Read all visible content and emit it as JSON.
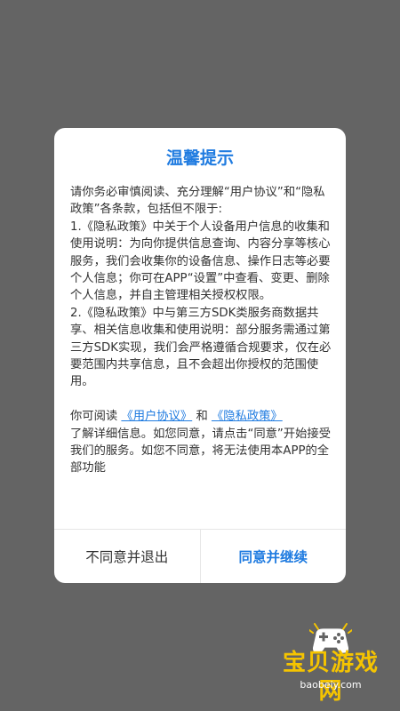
{
  "dialog": {
    "title": "温馨提示",
    "intro": "请你务必审慎阅读、充分理解“用户协议”和“隐私政策”各条款，包括但不限于:",
    "item1": "1.《隐私政策》中关于个人设备用户信息的收集和使用说明：为向你提供信息查询、内容分享等核心服务，我们会收集你的设备信息、操作日志等必要个人信息；你可在APP“设置”中查看、变更、删除个人信息，并自主管理相关授权权限。",
    "item2": "2.《隐私政策》中与第三方SDK类服务商数据共享、相关信息收集和使用说明：部分服务需通过第三方SDK实现，我们会严格遵循合规要求，仅在必要范围内共享信息，且不会超出你授权的范围使用。",
    "read_prefix": "你可阅读",
    "link_user_agreement": "《用户协议》",
    "and": "和",
    "link_privacy_policy": "《隐私政策》",
    "outro": "了解详细信息。如您同意，请点击“同意”开始接受我们的服务。如您不同意，将无法使用本APP的全部功能",
    "btn_disagree": "不同意并退出",
    "btn_agree": "同意并继续"
  },
  "watermark": {
    "title": "宝贝游戏网",
    "url": "baobeiy.com",
    "icon": "gamepad-icon"
  },
  "colors": {
    "backdrop": "#646464",
    "accent": "#1f7be0",
    "text": "#333333",
    "watermark": "#f5c400"
  }
}
